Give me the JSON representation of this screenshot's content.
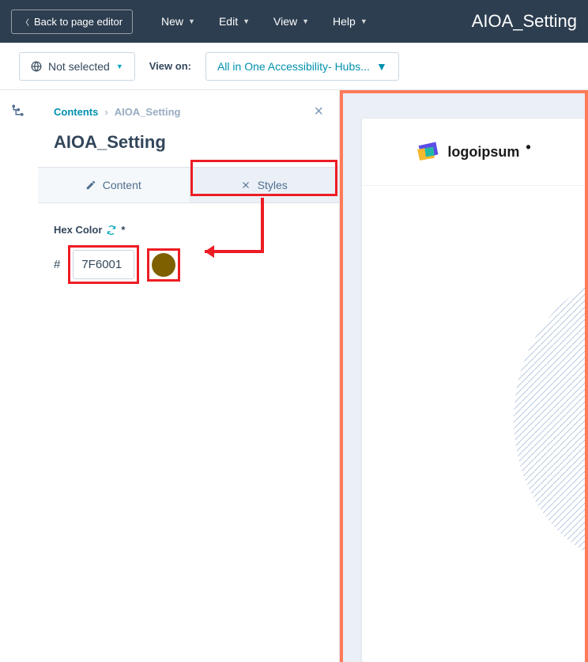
{
  "header": {
    "back_label": "Back to page editor",
    "menus": {
      "new": "New",
      "edit": "Edit",
      "view": "View",
      "help": "Help"
    },
    "title": "AIOA_Setting"
  },
  "toolbar": {
    "not_selected": "Not selected",
    "view_on": "View on:",
    "view_on_value": "All in One Accessibility- Hubs..."
  },
  "sidebar": {
    "breadcrumb_link": "Contents",
    "breadcrumb_current": "AIOA_Setting",
    "title": "AIOA_Setting",
    "tabs": {
      "content": "Content",
      "styles": "Styles"
    },
    "field_label": "Hex Color",
    "required": "*",
    "hash": "#",
    "hex_value": "7F6001",
    "swatch_color": "#7f6001"
  },
  "preview": {
    "logo_text": "logoipsum"
  }
}
